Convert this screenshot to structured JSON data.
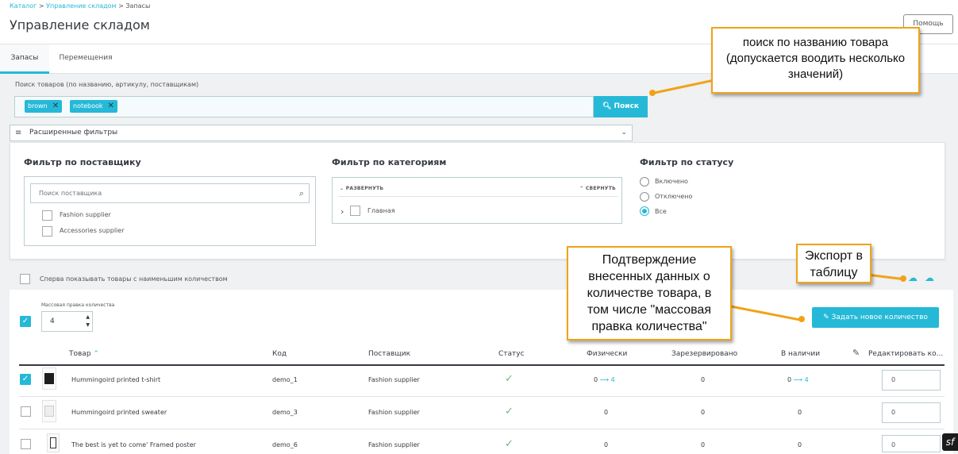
{
  "breadcrumb": {
    "item1": "Каталог",
    "sep": ">",
    "item2": "Управление складом",
    "item3": "Запасы"
  },
  "page_title": "Управление складом",
  "help_label": "Помощь",
  "tabs": [
    {
      "label": "Запасы"
    },
    {
      "label": "Перемещения"
    }
  ],
  "search": {
    "label": "Поиск товаров (по названию, артикулу, поставщикам)",
    "chips": [
      {
        "label": "brown"
      },
      {
        "label": "notebook"
      }
    ],
    "button_label": "Поиск"
  },
  "advanced_filters_label": "Расширенные фильтры",
  "filters": {
    "supplier": {
      "title": "Фильтр по поставщику",
      "placeholder": "Поиск поставщика",
      "options": [
        {
          "label": "Fashion supplier"
        },
        {
          "label": "Accessories supplier"
        }
      ]
    },
    "category": {
      "title": "Фильтр по категориям",
      "expand": "РАЗВЕРНУТЬ",
      "collapse": "СВЕРНУТЬ",
      "root": "Главная"
    },
    "status": {
      "title": "Фильтр по статусу",
      "options": [
        {
          "label": "Включено",
          "selected": false
        },
        {
          "label": "Отключено",
          "selected": false
        },
        {
          "label": "Все",
          "selected": true
        }
      ]
    }
  },
  "low_qty_label": "Сперва показывать товары с наименьшим количеством",
  "bulk": {
    "label": "Массовая правка количества",
    "value": "4",
    "button_label": "Задать новое количество"
  },
  "table": {
    "headers": {
      "product": "Товар",
      "reference": "Код",
      "supplier": "Поставщик",
      "status": "Статус",
      "physical": "Физически",
      "reserved": "Зарезервировано",
      "available": "В наличии",
      "edit": "Редактировать ко..."
    },
    "rows": [
      {
        "name": "Hummingoird printed t-shirt",
        "reference": "demo_1",
        "supplier": "Fashion supplier",
        "physical_from": "0",
        "physical_to": "4",
        "reserved": "0",
        "available_from": "0",
        "available_to": "4",
        "edit_value": "0",
        "checked": true
      },
      {
        "name": "Hummingoird printed sweater",
        "reference": "demo_3",
        "supplier": "Fashion supplier",
        "physical": "0",
        "reserved": "0",
        "available": "0",
        "edit_value": "0",
        "checked": false
      },
      {
        "name": "The best is yet to come' Framed poster",
        "reference": "demo_6",
        "supplier": "Fashion supplier",
        "physical": "0",
        "reserved": "0",
        "available": "0",
        "edit_value": "0",
        "checked": false
      }
    ]
  },
  "callouts": {
    "search": "поиск по названию товара (допускается  воодить несколько значений)",
    "confirm": "Подтверждение внесенных данных о количестве товара, в том числе \"массовая правка количества\"",
    "export": "Экспорт в таблицу"
  },
  "colors": {
    "accent": "#25b9d7",
    "callout_border": "#f0a318",
    "success": "#70b580"
  }
}
